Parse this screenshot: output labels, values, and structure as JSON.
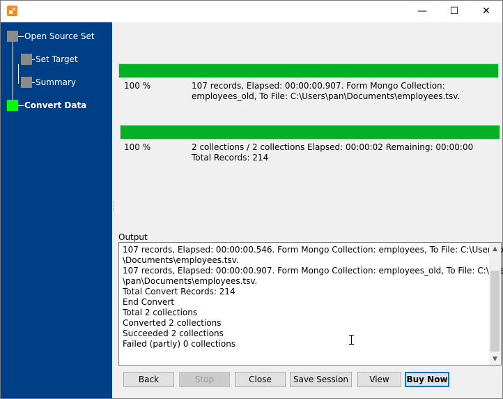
{
  "window": {
    "minimize_glyph": "—",
    "maximize_glyph": "☐",
    "close_glyph": "✕"
  },
  "sidebar": {
    "steps": [
      {
        "label": "Open Source Set",
        "state": "done"
      },
      {
        "label": "Set Target",
        "state": "done"
      },
      {
        "label": "Summary",
        "state": "done"
      },
      {
        "label": "Convert Data",
        "state": "active"
      }
    ],
    "colors": {
      "background": "#003e86",
      "inactive": "#8a8a8a",
      "active": "#00ff00"
    }
  },
  "progress1": {
    "value": 1.0,
    "percent": "100 %",
    "text": "107 records,    Elapsed: 00:00:00.907.    Form Mongo Collection: employees_old,    To File: C:\\Users\\pan\\Documents\\employees.tsv."
  },
  "progress2": {
    "value": 1.0,
    "percent": "100 %",
    "text": "2 collections / 2 collections     Elapsed: 00:00:02     Remaining: 00:00:00     Total Records: 214"
  },
  "output": {
    "label": "Output",
    "lines": [
      "107 records,    Elapsed: 00:00:00.546.    Form Mongo Collection: employees,    To File: C:\\Users\\pan",
      "\\Documents\\employees.tsv.",
      "107 records,    Elapsed: 00:00:00.907.    Form Mongo Collection: employees_old,    To File: C:\\Users",
      "\\pan\\Documents\\employees.tsv.",
      "Total Convert Records: 214",
      "End Convert",
      "Total 2 collections",
      "Converted 2 collections",
      "Succeeded 2 collections",
      "Failed (partly) 0 collections"
    ]
  },
  "buttons": {
    "back": "Back",
    "stop": "Stop",
    "close": "Close",
    "save_session": "Save Session",
    "view": "View",
    "buy_now": "Buy Now"
  },
  "colors": {
    "progress_fill": "#06b025",
    "focus_border": "#0078d7"
  }
}
